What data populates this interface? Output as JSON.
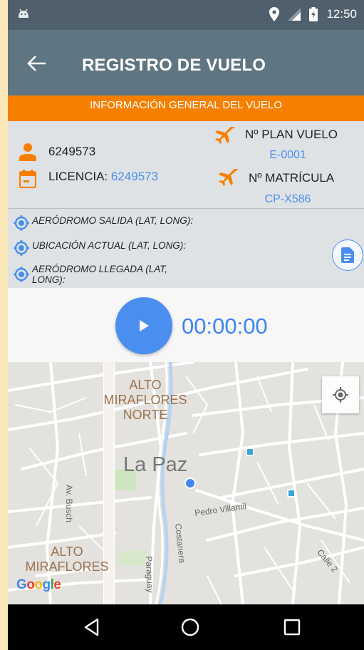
{
  "status_bar": {
    "time": "12:50",
    "icons": [
      "android-icon",
      "location-pin-icon",
      "signal-icon",
      "battery-charging-icon"
    ]
  },
  "app_bar": {
    "title": "REGISTRO DE VUELO",
    "back_icon": "arrow-left-icon"
  },
  "section_header": "INFORMACIÓN GENERAL DEL VUELO",
  "info": {
    "user_id": "6249573",
    "licencia_label": "LICENCIA:",
    "licencia_value": "6249573",
    "plan_vuelo_label": "Nº PLAN VUELO",
    "plan_vuelo_value": "E-0001",
    "matricula_label": "Nº MATRÍCULA",
    "matricula_value": "CP-X586"
  },
  "coordinates": {
    "salida_label": "AERÓDROMO SALIDA (LAT, LONG):",
    "actual_label": "UBICACIÓN ACTUAL (LAT, LONG):",
    "llegada_label_line1": "AERÓDROMO LLEGADA (LAT,",
    "llegada_label_line2": "LONG):"
  },
  "timer": {
    "value": "00:00:00"
  },
  "map": {
    "area_labels": {
      "alto_mira_norte_1": "ALTO",
      "alto_mira_norte_2": "MIRAFLORES",
      "alto_mira_norte_3": "NORTE",
      "alto_mira_1": "ALTO",
      "alto_mira_2": "MIRAFLORES"
    },
    "city": "La Paz",
    "streets": {
      "busch": "Av. Busch",
      "villamil": "Pedro Villamil",
      "costanera": "Costanera",
      "paraguay": "Paraguay",
      "calle2": "Calle 2"
    },
    "google": {
      "G": "G",
      "o1": "o",
      "o2": "o",
      "g": "g",
      "l": "l",
      "e": "e"
    }
  },
  "colors": {
    "status_bar": "#4f5f6b",
    "app_bar": "#5f7582",
    "accent_orange": "#f77f00",
    "accent_blue": "#4a8ff0",
    "info_bg": "#dfe2e4"
  }
}
